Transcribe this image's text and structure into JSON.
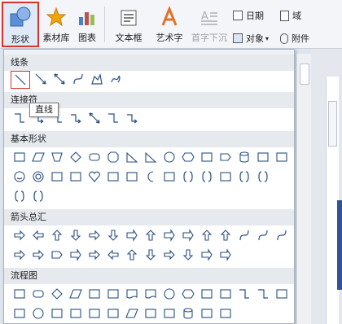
{
  "toolbar": {
    "shape": "形状",
    "material": "素材库",
    "chart": "图表",
    "textbox": "文本框",
    "wordart": "艺术字",
    "dropcap": "首字下沉",
    "date": "日期",
    "field": "域",
    "object": "对象",
    "attachment": "附件",
    "accent_color": "#d9342b"
  },
  "panel": {
    "categories": [
      "线条",
      "连接符",
      "基本形状",
      "箭头总汇",
      "流程图"
    ],
    "tooltip": "直线"
  },
  "icons": {
    "lines": [
      "line-icon",
      "arrow-icon",
      "double-arrow-icon",
      "curve-icon",
      "freeform-icon",
      "scribble-icon"
    ],
    "connectors": [
      "straight-connector-icon",
      "straight-arrow-connector-icon",
      "elbow-connector-icon",
      "elbow-arrow-connector-icon",
      "elbow-double-arrow-connector-icon",
      "curved-connector-icon",
      "curved-arrow-connector-icon"
    ],
    "basic": [
      "rectangle-icon",
      "parallelogram-icon",
      "trapezoid-icon",
      "diamond-icon",
      "rounded-rectangle-icon",
      "octagon-icon",
      "triangle-icon",
      "right-triangle-icon",
      "ellipse-icon",
      "hexagon-icon",
      "cross-icon",
      "pentagon-icon",
      "can-icon",
      "cube-icon",
      "bevel-icon",
      "folded-corner-icon",
      "smiley-icon",
      "donut-icon",
      "no-symbol-icon",
      "block-arc-icon",
      "heart-icon",
      "lightning-icon",
      "sun-icon",
      "moon-icon",
      "arc-icon",
      "double-bracket-icon",
      "double-brace-icon",
      "plaque-icon",
      "left-bracket-icon",
      "right-bracket-icon",
      "left-brace-icon",
      "right-brace-icon"
    ],
    "arrows": [
      "right-arrow-icon",
      "left-arrow-icon",
      "up-arrow-icon",
      "down-arrow-icon",
      "left-right-arrow-icon",
      "up-down-arrow-icon",
      "quad-arrow-icon",
      "left-right-up-arrow-icon",
      "bent-arrow-icon",
      "u-turn-arrow-icon",
      "left-up-arrow-icon",
      "bent-up-arrow-icon",
      "curved-right-arrow-icon",
      "curved-left-arrow-icon",
      "curved-up-arrow-icon",
      "curved-down-arrow-icon",
      "striped-right-arrow-icon",
      "notched-right-arrow-icon",
      "pentagon-arrow-icon",
      "chevron-icon",
      "right-arrow-callout-icon",
      "left-arrow-callout-icon",
      "up-arrow-callout-icon",
      "down-arrow-callout-icon",
      "left-right-arrow-callout-icon",
      "up-down-arrow-callout-icon",
      "quad-arrow-callout-icon",
      "circular-arrow-icon"
    ],
    "flowchart": [
      "process-icon",
      "alternate-process-icon",
      "decision-icon",
      "data-icon",
      "predefined-process-icon",
      "internal-storage-icon",
      "document-icon",
      "multidocument-icon",
      "terminator-icon",
      "preparation-icon",
      "manual-input-icon",
      "manual-operation-icon",
      "connector-icon",
      "offpage-connector-icon",
      "card-icon",
      "punched-tape-icon",
      "summing-junction-icon",
      "or-icon",
      "collate-icon",
      "sort-icon",
      "extract-icon",
      "merge-icon",
      "stored-data-icon",
      "delay-icon",
      "sequential-access-storage-icon",
      "magnetic-disk-icon",
      "direct-access-storage-icon",
      "display-icon"
    ]
  }
}
